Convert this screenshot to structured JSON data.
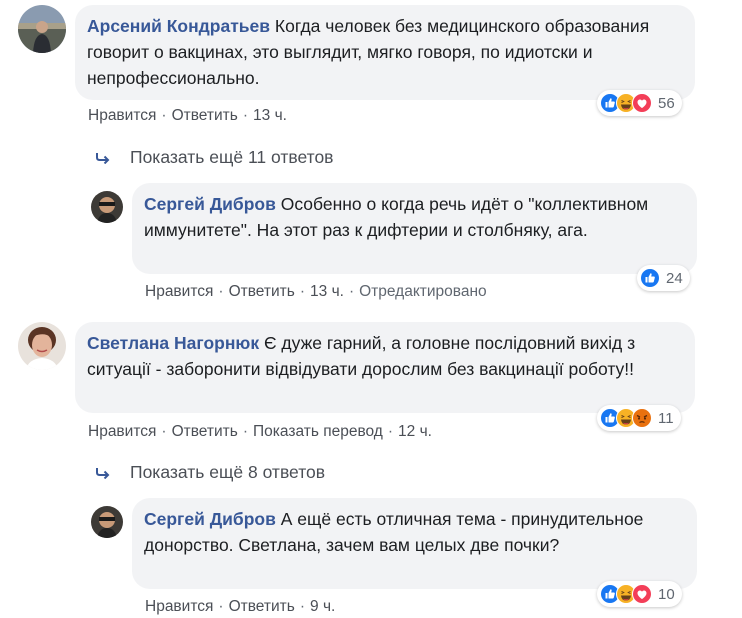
{
  "comments": [
    {
      "author": "Арсений Кондратьев",
      "text": "Когда человек без медицинского образования говорит о вакцинах, это выглядит, мягко говоря, по идиотски и непрофессионально.",
      "like": "Нравится",
      "reply": "Ответить",
      "time": "13 ч.",
      "reactions": [
        "like-icon",
        "haha-icon",
        "love-icon"
      ],
      "reaction_count": "56"
    },
    {
      "author": "Сергей Дибров",
      "text": "Особенно о когда речь идёт о \"коллективном иммунитете\". На этот раз к дифтерии и столбняку, ага.",
      "like": "Нравится",
      "reply": "Ответить",
      "time": "13 ч.",
      "edited": "Отредактировано",
      "reactions": [
        "like-icon"
      ],
      "reaction_count": "24"
    },
    {
      "author": "Светлана Нагорнюк",
      "text": "Є дуже гарний, а головне послідовний вихід з ситуації - заборонити відвідувати дорослим без вакцинації роботу!!",
      "like": "Нравится",
      "reply": "Ответить",
      "translate": "Показать перевод",
      "time": "12 ч.",
      "reactions": [
        "like-icon",
        "haha-icon",
        "angry-icon"
      ],
      "reaction_count": "11"
    },
    {
      "author": "Сергей Дибров",
      "text": "А ещё есть отличная тема - принудительное донорство. Светлана, зачем вам целых две почки?",
      "like": "Нравится",
      "reply": "Ответить",
      "time": "9 ч.",
      "reactions": [
        "like-icon",
        "haha-icon",
        "love-icon"
      ],
      "reaction_count": "10"
    }
  ],
  "more_replies": [
    "Показать ещё 11 ответов",
    "Показать ещё 8 ответов"
  ],
  "colors": {
    "link": "#385898",
    "bubble": "#f2f3f5",
    "like": "#1877f2",
    "haha": "#f7b125",
    "love": "#f33e58",
    "angry": "#e9710f"
  }
}
